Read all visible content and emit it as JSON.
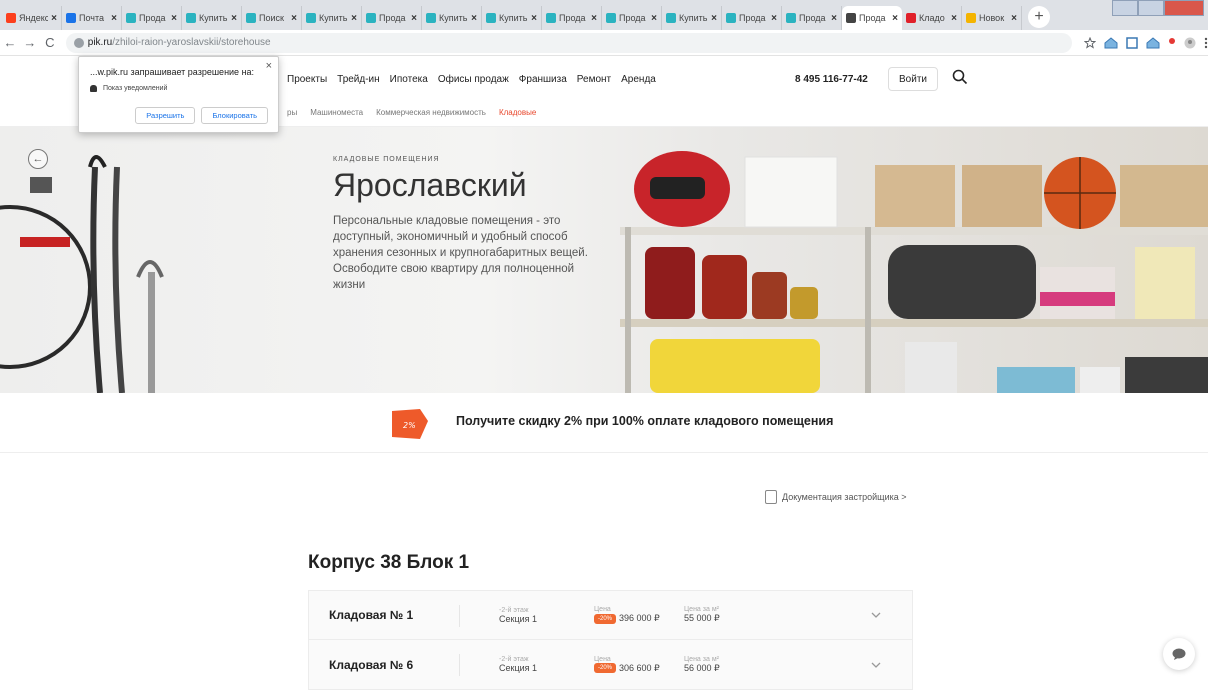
{
  "browser": {
    "tabs": [
      {
        "title": "Яндекс",
        "favicon_color": "#fc3f1d",
        "active": false
      },
      {
        "title": "Почта",
        "favicon_color": "#1a73e8",
        "active": false
      },
      {
        "title": "Прода",
        "favicon_color": "#2bb3c0",
        "active": false
      },
      {
        "title": "Купить",
        "favicon_color": "#2bb3c0",
        "active": false
      },
      {
        "title": "Поиск",
        "favicon_color": "#2bb3c0",
        "active": false
      },
      {
        "title": "Купить",
        "favicon_color": "#2bb3c0",
        "active": false
      },
      {
        "title": "Прода",
        "favicon_color": "#2bb3c0",
        "active": false
      },
      {
        "title": "Купить",
        "favicon_color": "#2bb3c0",
        "active": false
      },
      {
        "title": "Купить",
        "favicon_color": "#2bb3c0",
        "active": false
      },
      {
        "title": "Прода",
        "favicon_color": "#2bb3c0",
        "active": false
      },
      {
        "title": "Прода",
        "favicon_color": "#2bb3c0",
        "active": false
      },
      {
        "title": "Купить",
        "favicon_color": "#2bb3c0",
        "active": false
      },
      {
        "title": "Прода",
        "favicon_color": "#2bb3c0",
        "active": false
      },
      {
        "title": "Прода",
        "favicon_color": "#2bb3c0",
        "active": false
      },
      {
        "title": "Прода",
        "favicon_color": "#444444",
        "active": true
      },
      {
        "title": "Кладо",
        "favicon_color": "#e0202a",
        "active": false
      },
      {
        "title": "Новок",
        "favicon_color": "#f4b400",
        "active": false
      }
    ],
    "close_glyph": "×",
    "new_tab_glyph": "+",
    "url_host": "pik.ru",
    "url_path": "/zhiloi-raion-yaroslavskii/storehouse",
    "back_glyph": "←",
    "forward_glyph": "→",
    "reload_glyph": "C"
  },
  "notification": {
    "title": "...w.pik.ru запрашивает разрешение на:",
    "close": "×",
    "permission": "Показ уведомлений",
    "allow": "Разрешить",
    "block": "Блокировать"
  },
  "header": {
    "nav": [
      "Проекты",
      "Трейд-ин",
      "Ипотека",
      "Офисы продаж",
      "Франшиза",
      "Ремонт",
      "Аренда"
    ],
    "phone": "8 495 116-77-42",
    "login": "Войти"
  },
  "subnav": {
    "items": [
      {
        "label": "ры",
        "active": false
      },
      {
        "label": "Машиноместа",
        "active": false
      },
      {
        "label": "Коммерческая недвижимость",
        "active": false
      },
      {
        "label": "Кладовые",
        "active": true
      }
    ]
  },
  "hero": {
    "eyebrow": "КЛАДОВЫЕ ПОМЕЩЕНИЯ",
    "title": "Ярославский",
    "description": "Персональные кладовые помещения - это доступный, экономичный и удобный способ хранения сезонных и крупногабаритных вещей. Освободите свою квартиру для полноценной жизни"
  },
  "promo": {
    "tag_text": "2%",
    "text": "Получите скидку 2% при 100% оплате кладового помещения"
  },
  "docs_link": "Документация застройщика  >",
  "section_title": "Корпус 38 Блок 1",
  "storerooms": [
    {
      "name": "Кладовая № 1",
      "floor_label": "-2-й этаж",
      "section": "Секция 1",
      "price_label": "Цена",
      "discount": "-20%",
      "price": "396 000 ₽",
      "ppm_label": "Цена за м²",
      "price_per_m2": "55 000 ₽"
    },
    {
      "name": "Кладовая № 6",
      "floor_label": "-2-й этаж",
      "section": "Секция 1",
      "price_label": "Цена",
      "discount": "-20%",
      "price": "306 600 ₽",
      "ppm_label": "Цена за м²",
      "price_per_m2": "56 000 ₽"
    }
  ],
  "colors": {
    "accent": "#e8472c",
    "discount": "#f06931"
  }
}
